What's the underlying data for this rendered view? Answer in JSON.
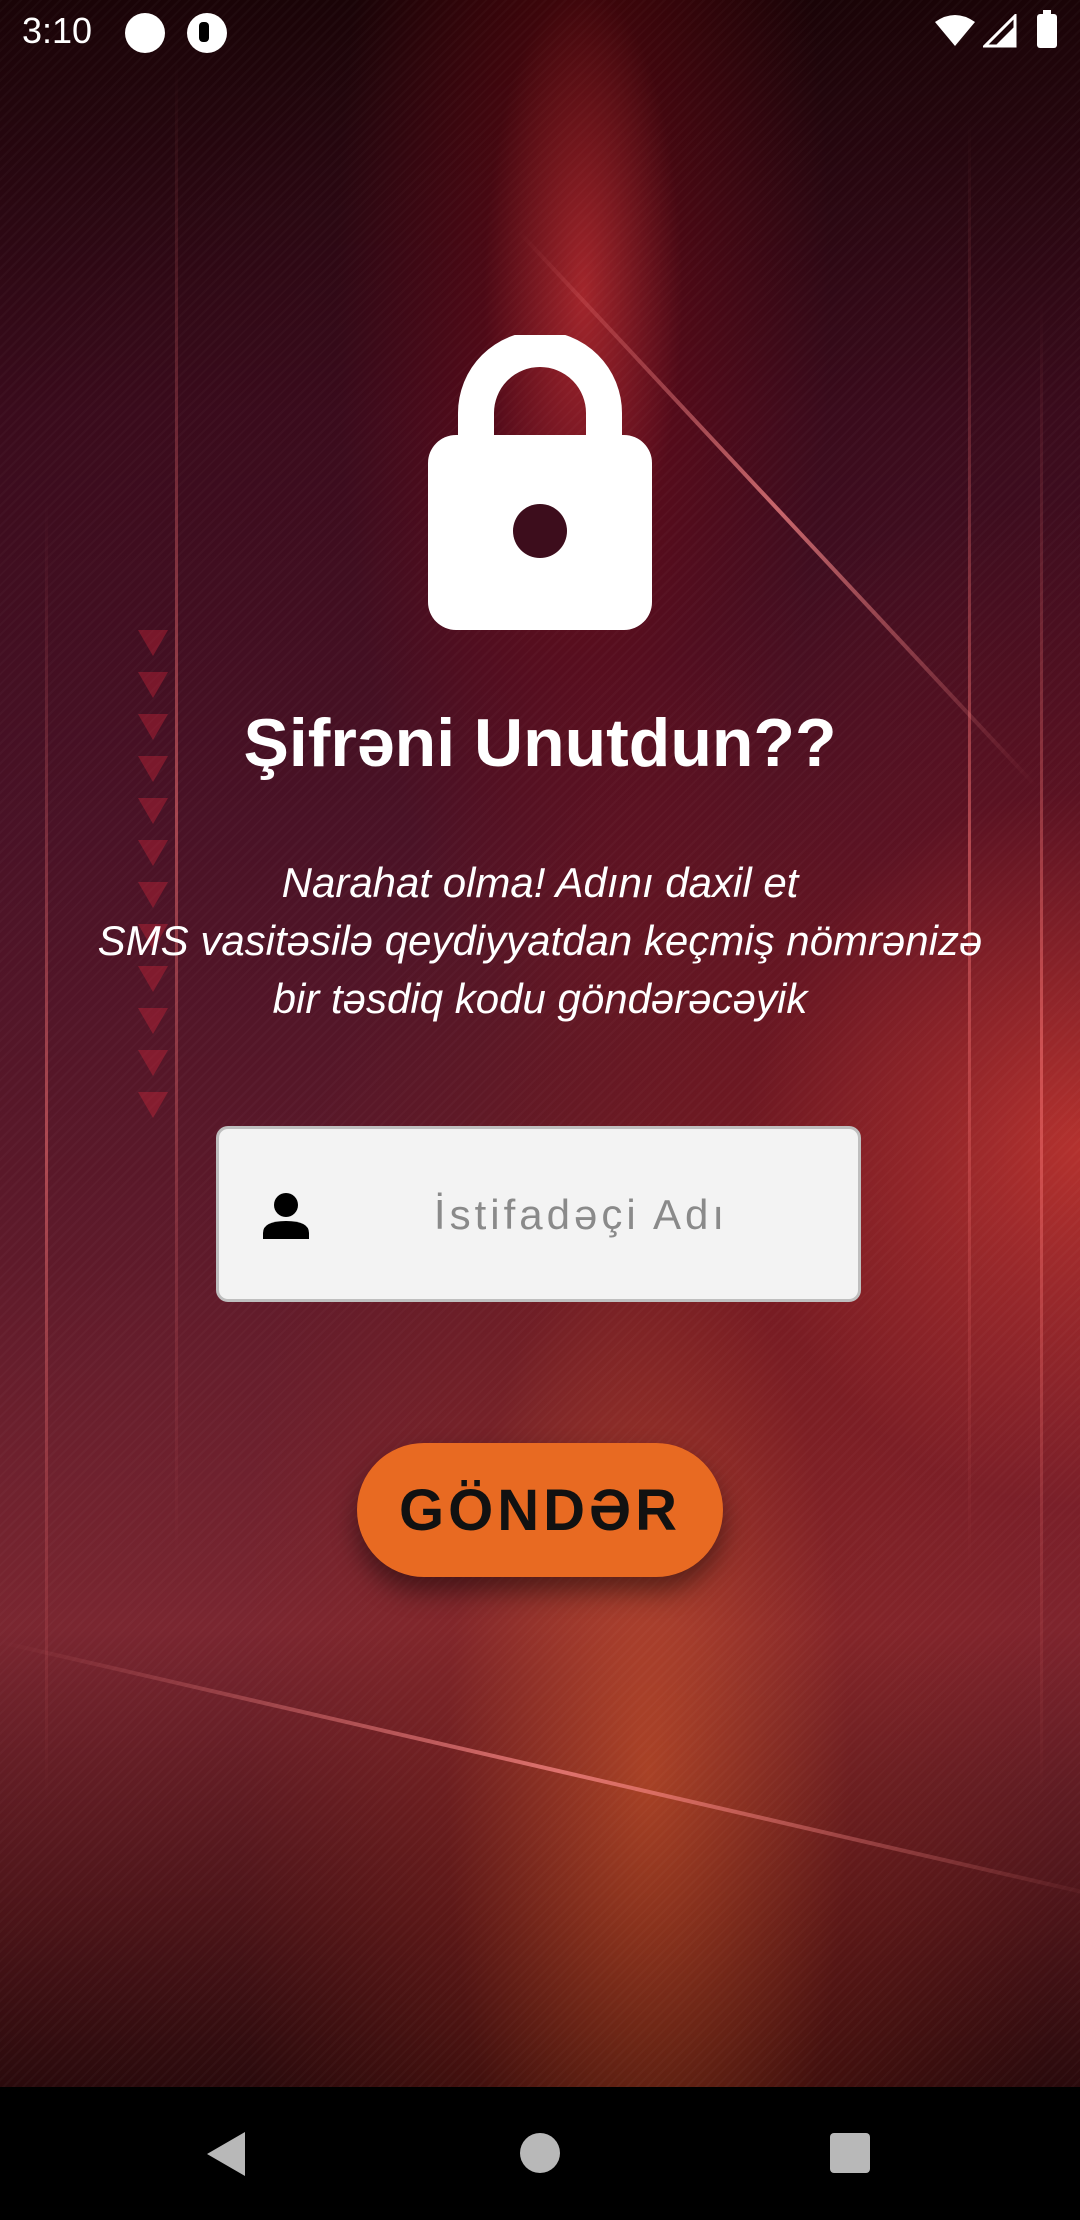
{
  "status_bar": {
    "time": "3:10",
    "icons": [
      "notification-dot-icon",
      "app-notification-icon",
      "wifi-icon",
      "signal-icon",
      "battery-icon"
    ]
  },
  "screen": {
    "lock_icon": "lock-icon",
    "title": "Şifrəni Unutdun??",
    "subtitle_lines": [
      "Narahat olma! Adını daxil et",
      "SMS vasitəsilə qeydiyyatdan keçmiş nömrənizə",
      "bir təsdiq kodu göndərəcəyik"
    ]
  },
  "username_field": {
    "icon": "person-icon",
    "placeholder": "İstifadəçi Adı",
    "value": ""
  },
  "send_button": {
    "label": "GÖNDƏR"
  },
  "colors": {
    "button_bg": "#e86a22",
    "input_bg": "#f3f3f3",
    "text_primary": "#ffffff"
  },
  "nav_bar": {
    "icons": [
      "back-icon",
      "home-icon",
      "recents-icon"
    ]
  }
}
